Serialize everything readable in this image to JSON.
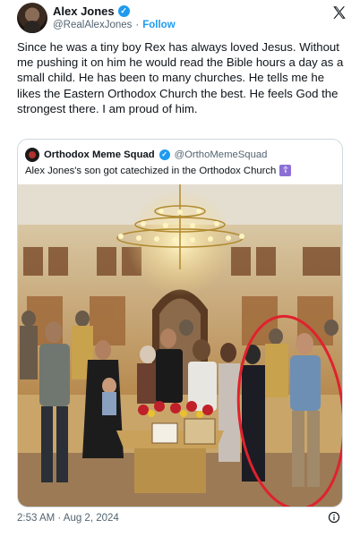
{
  "author": {
    "display_name": "Alex Jones",
    "handle": "@RealAlexJones",
    "separator": "·",
    "follow_label": "Follow"
  },
  "tweet": {
    "text": "Since he was a tiny boy Rex has always loved Jesus. Without me pushing it on him he would read the Bible hours a day as a small child. He has been to many churches. He tells me he likes the Eastern Orthodox Church the best. He feels God the strongest there. I am proud of him."
  },
  "quoted": {
    "display_name": "Orthodox Meme Squad",
    "handle": "@OrthoMemeSquad",
    "text": "Alex Jones's son got catechized in the Orthodox Church",
    "emoji": "☦"
  },
  "footer": {
    "timestamp": "2:53 AM · Aug 2, 2024"
  },
  "icons": {
    "verified": "verified-badge-icon",
    "x_logo": "x-logo-icon",
    "info": "info-icon",
    "cross": "orthodox-cross-icon"
  },
  "colors": {
    "accent": "#1d9bf0",
    "text": "#0f1419",
    "muted": "#536471",
    "border": "#cfd9de",
    "highlight_circle": "#e0222e"
  }
}
